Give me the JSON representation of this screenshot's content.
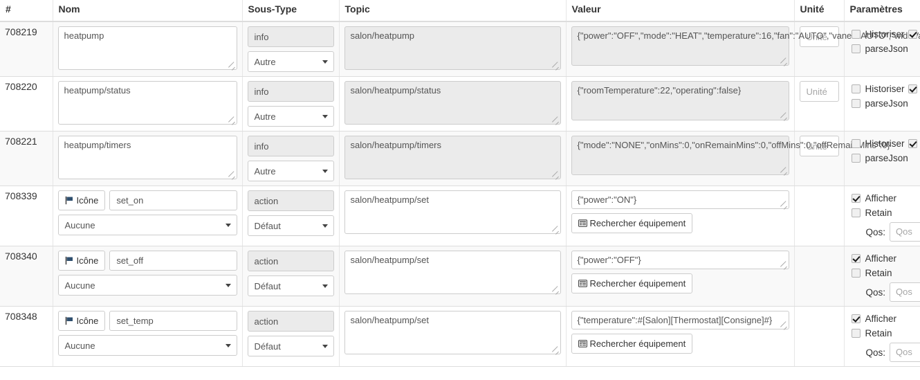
{
  "table": {
    "headers": [
      "#",
      "Nom",
      "Sous-Type",
      "Topic",
      "Valeur",
      "Unité",
      "Paramètres"
    ],
    "labels": {
      "icone_button": "Icône",
      "rechercher_button": "Rechercher équipement",
      "historiser": "Historiser",
      "parsejson": "parseJson",
      "afficher": "Afficher",
      "retain": "Retain",
      "qos_label": "Qos:",
      "qos_placeholder": "Qos",
      "unite_placeholder": "Unité",
      "icon_flag": "flag-icon",
      "icon_list": "list-icon"
    },
    "rows": [
      {
        "id": "708219",
        "kind": "info",
        "name": "heatpump",
        "type": "info",
        "subtype": "Autre",
        "topic": "salon/heatpump",
        "valeur": "{\"power\":\"OFF\",\"mode\":\"HEAT\",\"temperature\":16,\"fan\":\"AUTO\",\"vane\":\"AUTO\",\"wideVane\":\"|\"}",
        "unite": "Unité",
        "historiser": false,
        "historiser_trailing": true,
        "parsejson": false,
        "striped": true
      },
      {
        "id": "708220",
        "kind": "info",
        "name": "heatpump/status",
        "type": "info",
        "subtype": "Autre",
        "topic": "salon/heatpump/status",
        "valeur": "{\"roomTemperature\":22,\"operating\":false}",
        "unite": "Unité",
        "historiser": false,
        "historiser_trailing": true,
        "parsejson": false,
        "striped": false
      },
      {
        "id": "708221",
        "kind": "info",
        "name": "heatpump/timers",
        "type": "info",
        "subtype": "Autre",
        "topic": "salon/heatpump/timers",
        "valeur": "{\"mode\":\"NONE\",\"onMins\":0,\"onRemainMins\":0,\"offMins\":0,\"offRemainMins\":0}",
        "unite": "Unité",
        "historiser": false,
        "historiser_trailing": true,
        "parsejson": false,
        "striped": true
      },
      {
        "id": "708339",
        "kind": "action",
        "name": "set_on",
        "icone": "Icône",
        "icone_select": "Aucune",
        "type": "action",
        "subtype": "Défaut",
        "topic": "salon/heatpump/set",
        "valeur": "{\"power\":\"ON\"}",
        "rechercher": "Rechercher équipement",
        "unite": "",
        "afficher": true,
        "retain": false,
        "qos": "Qos",
        "striped": false
      },
      {
        "id": "708340",
        "kind": "action",
        "name": "set_off",
        "icone": "Icône",
        "icone_select": "Aucune",
        "type": "action",
        "subtype": "Défaut",
        "topic": "salon/heatpump/set",
        "valeur": "{\"power\":\"OFF\"}",
        "rechercher": "Rechercher équipement",
        "unite": "",
        "afficher": true,
        "retain": false,
        "qos": "Qos",
        "striped": true
      },
      {
        "id": "708348",
        "kind": "action",
        "name": "set_temp",
        "icone": "Icône",
        "icone_select": "Aucune",
        "type": "action",
        "subtype": "Défaut",
        "topic": "salon/heatpump/set",
        "valeur": "{\"temperature\":#[Salon][Thermostat][Consigne]#}",
        "rechercher": "Rechercher équipement",
        "unite": "",
        "afficher": true,
        "retain": false,
        "qos": "Qos",
        "striped": false
      }
    ]
  },
  "colors": {
    "border": "#dddddd",
    "stripe": "#f9f9f9",
    "readonly_bg": "#ebebeb",
    "text": "#333333",
    "placeholder": "#a6a6a6"
  }
}
